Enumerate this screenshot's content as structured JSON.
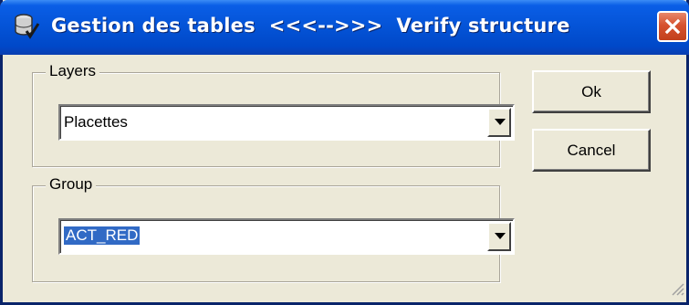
{
  "window": {
    "title": "Gestion des tables  <<<-->>>  Verify structure",
    "title_icon": "database-check-icon",
    "close_icon": "close-icon"
  },
  "layers": {
    "legend": "Layers",
    "selected": "Placettes"
  },
  "group": {
    "legend": "Group",
    "selected": "ACT_RED"
  },
  "buttons": {
    "ok": "Ok",
    "cancel": "Cancel"
  },
  "colors": {
    "titlebar": "#0453d6",
    "dialog_bg": "#ece9d8",
    "selection": "#316ac5",
    "close": "#d6522f"
  }
}
